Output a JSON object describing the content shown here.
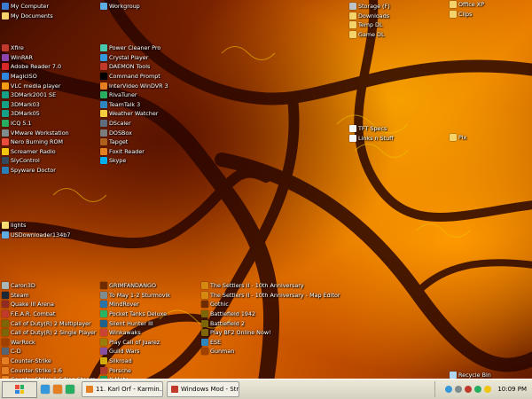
{
  "desktop": {
    "columns": [
      {
        "id": "col1-top",
        "items": [
          {
            "label": "My Computer",
            "icon": "computer-icon",
            "color": "#3b7bd1"
          },
          {
            "label": "My Documents",
            "icon": "folder-icon",
            "color": "#f5d36b"
          }
        ]
      },
      {
        "id": "col1-mid",
        "items": [
          {
            "label": "Xfire",
            "icon": "xfire-icon",
            "color": "#c0392b"
          },
          {
            "label": "WinRAR",
            "icon": "winrar-icon",
            "color": "#8e44ad"
          },
          {
            "label": "Adobe Reader 7.0",
            "icon": "pdf-icon",
            "color": "#d62828"
          },
          {
            "label": "MagicISO",
            "icon": "disc-icon",
            "color": "#2e86de"
          },
          {
            "label": "VLC media player",
            "icon": "vlc-icon",
            "color": "#f39c12"
          },
          {
            "label": "3DMark2001 SE",
            "icon": "benchmark-icon",
            "color": "#16a085"
          },
          {
            "label": "3DMark03",
            "icon": "benchmark-icon",
            "color": "#16a085"
          },
          {
            "label": "3DMark05",
            "icon": "benchmark-icon",
            "color": "#16a085"
          },
          {
            "label": "ICQ 5.1",
            "icon": "icq-icon",
            "color": "#27ae60"
          },
          {
            "label": "VMware Workstation",
            "icon": "vm-icon",
            "color": "#7f8c8d"
          },
          {
            "label": "Nero Burning ROM",
            "icon": "nero-icon",
            "color": "#e74c3c"
          },
          {
            "label": "Screamer Radio",
            "icon": "radio-icon",
            "color": "#f1c40f"
          },
          {
            "label": "SlyControl",
            "icon": "app-icon",
            "color": "#34495e"
          },
          {
            "label": "Spyware Doctor",
            "icon": "shield-icon",
            "color": "#2980b9"
          }
        ]
      },
      {
        "id": "col1-lights",
        "items": [
          {
            "label": "lights",
            "icon": "bulb-icon",
            "color": "#f7dc6f"
          },
          {
            "label": "USDownloader134b7",
            "icon": "download-icon",
            "color": "#5dade2"
          }
        ]
      },
      {
        "id": "col1-bottom",
        "items": [
          {
            "label": "Caron3D",
            "icon": "app-icon",
            "color": "#aab7b8"
          },
          {
            "label": "Steam",
            "icon": "steam-icon",
            "color": "#1b2838"
          },
          {
            "label": "Quake III Arena",
            "icon": "quake-icon",
            "color": "#922b21"
          },
          {
            "label": "F.E.A.R. Combat",
            "icon": "game-icon",
            "color": "#c0392b"
          },
          {
            "label": "Call of Duty(R) 2 Multiplayer",
            "icon": "game-icon",
            "color": "#7d6608"
          },
          {
            "label": "Call of Duty(R) 2 Single Player",
            "icon": "game-icon",
            "color": "#7d6608"
          },
          {
            "label": "WarRock",
            "icon": "game-icon",
            "color": "#a04000"
          },
          {
            "label": "C-D",
            "icon": "app-icon",
            "color": "#566573"
          },
          {
            "label": "Counter-Strike",
            "icon": "cs-icon",
            "color": "#e67e22"
          },
          {
            "label": "Counter-Strike 1.6",
            "icon": "cs-icon",
            "color": "#e67e22"
          },
          {
            "label": "Counter Strike 1.6 Non Steam",
            "icon": "cs-icon",
            "color": "#e67e22"
          }
        ]
      },
      {
        "id": "col2-top",
        "items": [
          {
            "label": "Workgroup",
            "icon": "network-icon",
            "color": "#5dade2"
          }
        ]
      },
      {
        "id": "col2-mid",
        "items": [
          {
            "label": "Power Cleaner Pro",
            "icon": "app-icon",
            "color": "#48c9b0"
          },
          {
            "label": "Crystal Player",
            "icon": "player-icon",
            "color": "#3498db"
          },
          {
            "label": "DAEMON Tools",
            "icon": "daemon-icon",
            "color": "#c0392b"
          },
          {
            "label": "Command Prompt",
            "icon": "terminal-icon",
            "color": "#000000"
          },
          {
            "label": "InterVideo WinDVR 3",
            "icon": "dvr-icon",
            "color": "#e67e22"
          },
          {
            "label": "RivaTuner",
            "icon": "app-icon",
            "color": "#27ae60"
          },
          {
            "label": "TeamTalk 3",
            "icon": "chat-icon",
            "color": "#2e86c1"
          },
          {
            "label": "Weather Watcher",
            "icon": "weather-icon",
            "color": "#f4d03f"
          },
          {
            "label": "DScaler",
            "icon": "app-icon",
            "color": "#5d6d7e"
          },
          {
            "label": "DOSBox",
            "icon": "dosbox-icon",
            "color": "#7b7d7d"
          },
          {
            "label": "Tapget",
            "icon": "app-icon",
            "color": "#af601a"
          },
          {
            "label": "Foxit Reader",
            "icon": "pdf-icon",
            "color": "#e67e22"
          },
          {
            "label": "Skype",
            "icon": "skype-icon",
            "color": "#00aff0"
          }
        ]
      },
      {
        "id": "col2-bottom",
        "items": [
          {
            "label": "GRIMFANDANGO",
            "icon": "game-icon",
            "color": "#6e2c00"
          },
          {
            "label": "To May 1-2 Sturmovik",
            "icon": "plane-icon",
            "color": "#7f8c8d"
          },
          {
            "label": "MindRover",
            "icon": "game-icon",
            "color": "#2874a6"
          },
          {
            "label": "Pocket Tanks Deluxe",
            "icon": "tank-icon",
            "color": "#28b463"
          },
          {
            "label": "Silent Hunter III",
            "icon": "sub-icon",
            "color": "#1f618d"
          },
          {
            "label": "Winkawaks",
            "icon": "game-icon",
            "color": "#cb4335"
          },
          {
            "label": "Play Call of Juarez",
            "icon": "game-icon",
            "color": "#9a7d0a"
          },
          {
            "label": "Guild Wars",
            "icon": "game-icon",
            "color": "#884ea0"
          },
          {
            "label": "Silkroad",
            "icon": "game-icon",
            "color": "#d4ac0d"
          },
          {
            "label": "Porsche",
            "icon": "car-icon",
            "color": "#b03a2e"
          },
          {
            "label": "X-Moto",
            "icon": "moto-icon",
            "color": "#229954"
          }
        ]
      },
      {
        "id": "col3-bottom",
        "items": [
          {
            "label": "The Settlers II - 10th Anniversary",
            "icon": "game-icon",
            "color": "#d68910"
          },
          {
            "label": "The Settlers II - 10th Anniversary - Map Editor",
            "icon": "game-icon",
            "color": "#d68910"
          },
          {
            "label": "Gothic",
            "icon": "game-icon",
            "color": "#6e2c00"
          },
          {
            "label": "Battlefield 1942",
            "icon": "game-icon",
            "color": "#7d6608"
          },
          {
            "label": "Battlefield 2",
            "icon": "game-icon",
            "color": "#7d6608"
          },
          {
            "label": "Play BF2 Online Now!",
            "icon": "game-icon",
            "color": "#7d6608"
          },
          {
            "label": "ESE",
            "icon": "app-icon",
            "color": "#2e86c1"
          },
          {
            "label": "Gunman",
            "icon": "game-icon",
            "color": "#a04000"
          }
        ]
      },
      {
        "id": "col4-top",
        "items": [
          {
            "label": "Storage (F)",
            "icon": "drive-icon",
            "color": "#bdc3c7"
          },
          {
            "label": "Downloads",
            "icon": "folder-icon",
            "color": "#f5d36b"
          },
          {
            "label": "Temp DL",
            "icon": "folder-icon",
            "color": "#f5d36b"
          },
          {
            "label": "Game DL",
            "icon": "folder-icon",
            "color": "#f5d36b"
          }
        ]
      },
      {
        "id": "col4-mid",
        "items": [
          {
            "label": "TFT Specs",
            "icon": "document-icon",
            "color": "#f7f9f9"
          },
          {
            "label": "Links n Stuff",
            "icon": "document-icon",
            "color": "#f7f9f9"
          }
        ]
      },
      {
        "id": "col5-top",
        "items": [
          {
            "label": "Office XP",
            "icon": "folder-icon",
            "color": "#f5d36b"
          },
          {
            "label": "Clips",
            "icon": "folder-icon",
            "color": "#f5d36b"
          }
        ]
      },
      {
        "id": "col5-mid",
        "items": [
          {
            "label": "Pix",
            "icon": "folder-icon",
            "color": "#f5d36b"
          }
        ]
      },
      {
        "id": "col5-bottom",
        "items": [
          {
            "label": "Recycle Bin",
            "icon": "recycle-bin-icon",
            "color": "#aed6f1"
          }
        ]
      }
    ]
  },
  "taskbar": {
    "quicklaunch": [
      {
        "icon": "desktop-icon",
        "color": "#3498db"
      },
      {
        "icon": "firefox-icon",
        "color": "#e67e22"
      },
      {
        "icon": "media-icon",
        "color": "#27ae60"
      }
    ],
    "tasks": [
      {
        "label": "11. Karl Orf - Karmin...",
        "icon": "winamp-icon",
        "color": "#e67e22"
      },
      {
        "label": "Windows Mod - Stra...",
        "icon": "opera-icon",
        "color": "#c0392b"
      }
    ],
    "tray_icons": [
      {
        "icon": "network-tray-icon",
        "color": "#3498db"
      },
      {
        "icon": "volume-tray-icon",
        "color": "#7f8c8d"
      },
      {
        "icon": "security-tray-icon",
        "color": "#c0392b"
      },
      {
        "icon": "av-tray-icon",
        "color": "#27ae60"
      },
      {
        "icon": "chat-tray-icon",
        "color": "#f1c40f"
      }
    ],
    "clock": "10:09 PM"
  }
}
